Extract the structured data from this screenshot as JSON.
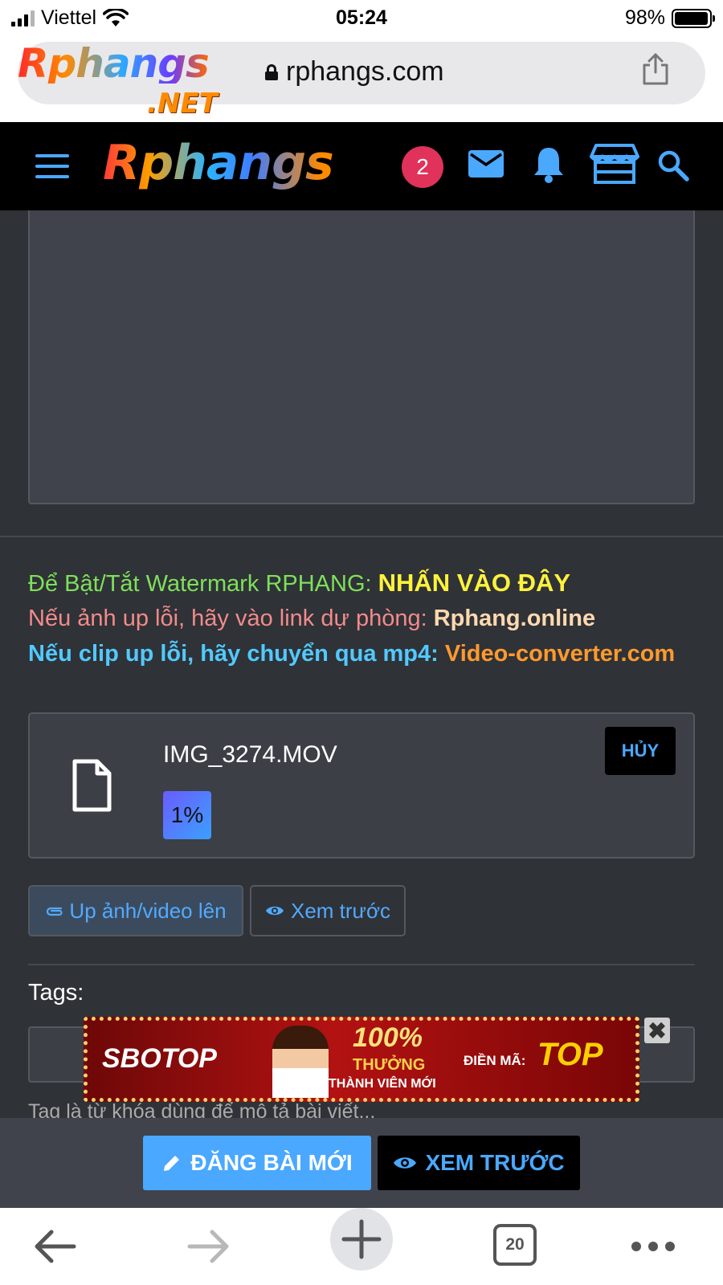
{
  "status_bar": {
    "carrier": "Viettel",
    "time": "05:24",
    "battery": "98%",
    "battery_level": 0.98
  },
  "browser": {
    "url": "rphangs.com",
    "tab_count": "20"
  },
  "favicon": {
    "logo": "Rphangs",
    "net": ".NET"
  },
  "header": {
    "logo": "Rphangs",
    "notification_count": "2"
  },
  "notices": {
    "watermark_label": "Để Bật/Tắt Watermark RPHANG:",
    "watermark_link": "NHẤN VÀO ĐÂY",
    "backup_label": "Nếu ảnh up lỗi, hãy vào link dự phòng:",
    "backup_link": "Rphang.online",
    "clip_label": "Nếu clip up lỗi, hãy chuyển qua mp4:",
    "clip_link": "Video-converter.com"
  },
  "upload": {
    "file_name": "IMG_3274.MOV",
    "progress": "1%",
    "progress_value": 0.01,
    "cancel_label": "HỦY"
  },
  "buttons": {
    "upload_label": "Up ảnh/video lên",
    "preview_label": "Xem trước",
    "post_label": "ĐĂNG BÀI MỚI",
    "preview_big_label": "XEM TRƯỚC"
  },
  "tags": {
    "label": "Tags:",
    "help_text": "Tag là từ khóa dùng để mô tả bài viết..."
  },
  "ad": {
    "brand": "SBOTOP",
    "headline": "100%",
    "sub": "THƯỞNG",
    "sub2": "THÀNH VIÊN MỚI",
    "code_label": "ĐIỀN MÃ:",
    "code": "TOP",
    "close": "✖"
  },
  "colors": {
    "accent": "#4aa8ff",
    "badge": "#e0325a",
    "notice_green": "#7ee05a",
    "notice_yellow": "#fff23c",
    "notice_pink": "#f28b8b",
    "notice_cyan": "#52c9ff",
    "notice_orange": "#ff9a2e"
  },
  "icons": {
    "header": [
      "menu-icon",
      "mail-icon",
      "bell-icon",
      "store-icon",
      "search-icon"
    ],
    "upload": [
      "file-icon",
      "paperclip-icon",
      "eye-icon",
      "pencil-icon"
    ],
    "toolbar": [
      "back-arrow-icon",
      "forward-arrow-icon",
      "plus-icon",
      "tabs-icon",
      "more-icon"
    ]
  }
}
